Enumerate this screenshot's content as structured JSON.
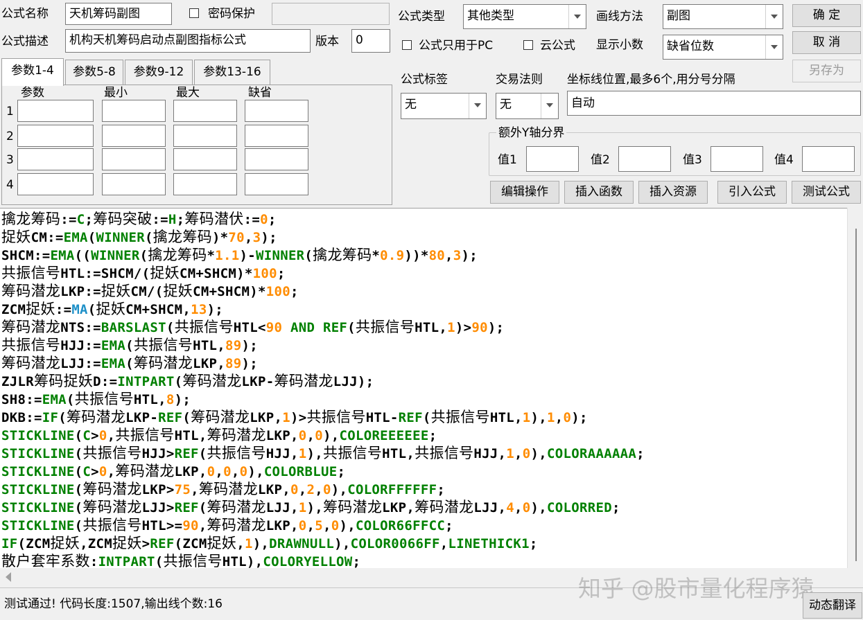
{
  "header": {
    "name_label": "公式名称",
    "name_value": "天机筹码副图",
    "password_label": "密码保护",
    "desc_label": "公式描述",
    "desc_value": "机构天机筹码启动点副图指标公式",
    "version_label": "版本",
    "version_value": "0",
    "type_label": "公式类型",
    "type_value": "其他类型",
    "draw_label": "画线方法",
    "draw_value": "副图",
    "pc_only_label": "公式只用于PC",
    "cloud_label": "云公式",
    "decimals_label": "显示小数",
    "decimals_value": "缺省位数",
    "ok_label": "确 定",
    "cancel_label": "取 消",
    "saveas_label": "另存为"
  },
  "tabs": [
    "参数1-4",
    "参数5-8",
    "参数9-12",
    "参数13-16"
  ],
  "params": {
    "headers": [
      "参数",
      "最小",
      "最大",
      "缺省"
    ],
    "rows": [
      "1",
      "2",
      "3",
      "4"
    ]
  },
  "options": {
    "tag_label": "公式标签",
    "tag_value": "无",
    "trade_label": "交易法则",
    "trade_value": "无",
    "coord_label": "坐标线位置,最多6个,用分号分隔",
    "coord_value": "自动",
    "yaxis_label": "额外Y轴分界",
    "v1": "值1",
    "v2": "值2",
    "v3": "值3",
    "v4": "值4"
  },
  "actions": [
    "编辑操作",
    "插入函数",
    "插入资源",
    "引入公式",
    "测试公式"
  ],
  "code": [
    [
      [
        "id",
        "擒龙筹码"
      ],
      [
        "txt",
        ":="
      ],
      [
        "fn",
        "C"
      ],
      [
        "txt",
        ";"
      ],
      [
        "id",
        "筹码突破"
      ],
      [
        "txt",
        ":="
      ],
      [
        "fn",
        "H"
      ],
      [
        "txt",
        ";"
      ],
      [
        "id",
        "筹码潜伏"
      ],
      [
        "txt",
        ":="
      ],
      [
        "num",
        "0"
      ],
      [
        "txt",
        ";"
      ]
    ],
    [
      [
        "id",
        "捉妖"
      ],
      [
        "txt",
        "CM:="
      ],
      [
        "fn",
        "EMA"
      ],
      [
        "txt",
        "("
      ],
      [
        "fn",
        "WINNER"
      ],
      [
        "txt",
        "("
      ],
      [
        "id",
        "擒龙筹码"
      ],
      [
        "txt",
        ")*"
      ],
      [
        "num",
        "70"
      ],
      [
        "txt",
        ","
      ],
      [
        "num",
        "3"
      ],
      [
        "txt",
        ");"
      ]
    ],
    [
      [
        "txt",
        "SHCM:="
      ],
      [
        "fn",
        "EMA"
      ],
      [
        "txt",
        "(("
      ],
      [
        "fn",
        "WINNER"
      ],
      [
        "txt",
        "("
      ],
      [
        "id",
        "擒龙筹码"
      ],
      [
        "txt",
        "*"
      ],
      [
        "num",
        "1.1"
      ],
      [
        "txt",
        ")-"
      ],
      [
        "fn",
        "WINNER"
      ],
      [
        "txt",
        "("
      ],
      [
        "id",
        "擒龙筹码"
      ],
      [
        "txt",
        "*"
      ],
      [
        "num",
        "0.9"
      ],
      [
        "txt",
        "))*"
      ],
      [
        "num",
        "80"
      ],
      [
        "txt",
        ","
      ],
      [
        "num",
        "3"
      ],
      [
        "txt",
        ");"
      ]
    ],
    [
      [
        "id",
        "共振信号"
      ],
      [
        "txt",
        "HTL:=SHCM/("
      ],
      [
        "id",
        "捉妖"
      ],
      [
        "txt",
        "CM+SHCM)*"
      ],
      [
        "num",
        "100"
      ],
      [
        "txt",
        ";"
      ]
    ],
    [
      [
        "id",
        "筹码潜龙"
      ],
      [
        "txt",
        "LKP:="
      ],
      [
        "id",
        "捉妖"
      ],
      [
        "txt",
        "CM/("
      ],
      [
        "id",
        "捉妖"
      ],
      [
        "txt",
        "CM+SHCM)*"
      ],
      [
        "num",
        "100"
      ],
      [
        "txt",
        ";"
      ]
    ],
    [
      [
        "txt",
        "ZCM"
      ],
      [
        "id",
        "捉妖"
      ],
      [
        "txt",
        ":="
      ],
      [
        "ma",
        "MA"
      ],
      [
        "txt",
        "("
      ],
      [
        "id",
        "捉妖"
      ],
      [
        "txt",
        "CM+SHCM,"
      ],
      [
        "num",
        "13"
      ],
      [
        "txt",
        ");"
      ]
    ],
    [
      [
        "id",
        "筹码潜龙"
      ],
      [
        "txt",
        "NTS:="
      ],
      [
        "fn",
        "BARSLAST"
      ],
      [
        "txt",
        "("
      ],
      [
        "id",
        "共振信号"
      ],
      [
        "txt",
        "HTL<"
      ],
      [
        "num",
        "90"
      ],
      [
        "txt",
        " "
      ],
      [
        "kw",
        "AND"
      ],
      [
        "txt",
        " "
      ],
      [
        "fn",
        "REF"
      ],
      [
        "txt",
        "("
      ],
      [
        "id",
        "共振信号"
      ],
      [
        "txt",
        "HTL,"
      ],
      [
        "num",
        "1"
      ],
      [
        "txt",
        ")>"
      ],
      [
        "num",
        "90"
      ],
      [
        "txt",
        ");"
      ]
    ],
    [
      [
        "id",
        "共振信号"
      ],
      [
        "txt",
        "HJJ:="
      ],
      [
        "fn",
        "EMA"
      ],
      [
        "txt",
        "("
      ],
      [
        "id",
        "共振信号"
      ],
      [
        "txt",
        "HTL,"
      ],
      [
        "num",
        "89"
      ],
      [
        "txt",
        ");"
      ]
    ],
    [
      [
        "id",
        "筹码潜龙"
      ],
      [
        "txt",
        "LJJ:="
      ],
      [
        "fn",
        "EMA"
      ],
      [
        "txt",
        "("
      ],
      [
        "id",
        "筹码潜龙"
      ],
      [
        "txt",
        "LKP,"
      ],
      [
        "num",
        "89"
      ],
      [
        "txt",
        ");"
      ]
    ],
    [
      [
        "txt",
        "ZJLR"
      ],
      [
        "id",
        "筹码捉妖"
      ],
      [
        "txt",
        "D:="
      ],
      [
        "fn",
        "INTPART"
      ],
      [
        "txt",
        "("
      ],
      [
        "id",
        "筹码潜龙"
      ],
      [
        "txt",
        "LKP-"
      ],
      [
        "id",
        "筹码潜龙"
      ],
      [
        "txt",
        "LJJ);"
      ]
    ],
    [
      [
        "txt",
        "SH8:="
      ],
      [
        "fn",
        "EMA"
      ],
      [
        "txt",
        "("
      ],
      [
        "id",
        "共振信号"
      ],
      [
        "txt",
        "HTL,"
      ],
      [
        "num",
        "8"
      ],
      [
        "txt",
        ");"
      ]
    ],
    [
      [
        "txt",
        "DKB:="
      ],
      [
        "fn",
        "IF"
      ],
      [
        "txt",
        "("
      ],
      [
        "id",
        "筹码潜龙"
      ],
      [
        "txt",
        "LKP-"
      ],
      [
        "fn",
        "REF"
      ],
      [
        "txt",
        "("
      ],
      [
        "id",
        "筹码潜龙"
      ],
      [
        "txt",
        "LKP,"
      ],
      [
        "num",
        "1"
      ],
      [
        "txt",
        ")>"
      ],
      [
        "id",
        "共振信号"
      ],
      [
        "txt",
        "HTL-"
      ],
      [
        "fn",
        "REF"
      ],
      [
        "txt",
        "("
      ],
      [
        "id",
        "共振信号"
      ],
      [
        "txt",
        "HTL,"
      ],
      [
        "num",
        "1"
      ],
      [
        "txt",
        "),"
      ],
      [
        "num",
        "1"
      ],
      [
        "txt",
        ","
      ],
      [
        "num",
        "0"
      ],
      [
        "txt",
        ");"
      ]
    ],
    [
      [
        "fn",
        "STICKLINE"
      ],
      [
        "txt",
        "("
      ],
      [
        "fn",
        "C"
      ],
      [
        "txt",
        ">"
      ],
      [
        "num",
        "0"
      ],
      [
        "txt",
        ","
      ],
      [
        "id",
        "共振信号"
      ],
      [
        "txt",
        "HTL,"
      ],
      [
        "id",
        "筹码潜龙"
      ],
      [
        "txt",
        "LKP,"
      ],
      [
        "num",
        "0"
      ],
      [
        "txt",
        ","
      ],
      [
        "num",
        "0"
      ],
      [
        "txt",
        "),"
      ],
      [
        "fn",
        "COLOREEEEEE"
      ],
      [
        "txt",
        ";"
      ]
    ],
    [
      [
        "fn",
        "STICKLINE"
      ],
      [
        "txt",
        "("
      ],
      [
        "id",
        "共振信号"
      ],
      [
        "txt",
        "HJJ>"
      ],
      [
        "fn",
        "REF"
      ],
      [
        "txt",
        "("
      ],
      [
        "id",
        "共振信号"
      ],
      [
        "txt",
        "HJJ,"
      ],
      [
        "num",
        "1"
      ],
      [
        "txt",
        "),"
      ],
      [
        "id",
        "共振信号"
      ],
      [
        "txt",
        "HTL,"
      ],
      [
        "id",
        "共振信号"
      ],
      [
        "txt",
        "HJJ,"
      ],
      [
        "num",
        "1"
      ],
      [
        "txt",
        ","
      ],
      [
        "num",
        "0"
      ],
      [
        "txt",
        "),"
      ],
      [
        "fn",
        "COLORAAAAAA"
      ],
      [
        "txt",
        ";"
      ]
    ],
    [
      [
        "fn",
        "STICKLINE"
      ],
      [
        "txt",
        "("
      ],
      [
        "fn",
        "C"
      ],
      [
        "txt",
        ">"
      ],
      [
        "num",
        "0"
      ],
      [
        "txt",
        ","
      ],
      [
        "id",
        "筹码潜龙"
      ],
      [
        "txt",
        "LKP,"
      ],
      [
        "num",
        "0"
      ],
      [
        "txt",
        ","
      ],
      [
        "num",
        "0"
      ],
      [
        "txt",
        ","
      ],
      [
        "num",
        "0"
      ],
      [
        "txt",
        "),"
      ],
      [
        "fn",
        "COLORBLUE"
      ],
      [
        "txt",
        ";"
      ]
    ],
    [
      [
        "fn",
        "STICKLINE"
      ],
      [
        "txt",
        "("
      ],
      [
        "id",
        "筹码潜龙"
      ],
      [
        "txt",
        "LKP>"
      ],
      [
        "num",
        "75"
      ],
      [
        "txt",
        ","
      ],
      [
        "id",
        "筹码潜龙"
      ],
      [
        "txt",
        "LKP,"
      ],
      [
        "num",
        "0"
      ],
      [
        "txt",
        ","
      ],
      [
        "num",
        "2"
      ],
      [
        "txt",
        ","
      ],
      [
        "num",
        "0"
      ],
      [
        "txt",
        "),"
      ],
      [
        "fn",
        "COLORFFFFFF"
      ],
      [
        "txt",
        ";"
      ]
    ],
    [
      [
        "fn",
        "STICKLINE"
      ],
      [
        "txt",
        "("
      ],
      [
        "id",
        "筹码潜龙"
      ],
      [
        "txt",
        "LJJ>"
      ],
      [
        "fn",
        "REF"
      ],
      [
        "txt",
        "("
      ],
      [
        "id",
        "筹码潜龙"
      ],
      [
        "txt",
        "LJJ,"
      ],
      [
        "num",
        "1"
      ],
      [
        "txt",
        "),"
      ],
      [
        "id",
        "筹码潜龙"
      ],
      [
        "txt",
        "LKP,"
      ],
      [
        "id",
        "筹码潜龙"
      ],
      [
        "txt",
        "LJJ,"
      ],
      [
        "num",
        "4"
      ],
      [
        "txt",
        ","
      ],
      [
        "num",
        "0"
      ],
      [
        "txt",
        "),"
      ],
      [
        "fn",
        "COLORRED"
      ],
      [
        "txt",
        ";"
      ]
    ],
    [
      [
        "fn",
        "STICKLINE"
      ],
      [
        "txt",
        "("
      ],
      [
        "id",
        "共振信号"
      ],
      [
        "txt",
        "HTL>="
      ],
      [
        "num",
        "90"
      ],
      [
        "txt",
        ","
      ],
      [
        "id",
        "筹码潜龙"
      ],
      [
        "txt",
        "LKP,"
      ],
      [
        "num",
        "0"
      ],
      [
        "txt",
        ","
      ],
      [
        "num",
        "5"
      ],
      [
        "txt",
        ","
      ],
      [
        "num",
        "0"
      ],
      [
        "txt",
        "),"
      ],
      [
        "fn",
        "COLOR66FFCC"
      ],
      [
        "txt",
        ";"
      ]
    ],
    [
      [
        "fn",
        "IF"
      ],
      [
        "txt",
        "(ZCM"
      ],
      [
        "id",
        "捉妖"
      ],
      [
        "txt",
        ",ZCM"
      ],
      [
        "id",
        "捉妖"
      ],
      [
        "txt",
        ">"
      ],
      [
        "fn",
        "REF"
      ],
      [
        "txt",
        "(ZCM"
      ],
      [
        "id",
        "捉妖"
      ],
      [
        "txt",
        ","
      ],
      [
        "num",
        "1"
      ],
      [
        "txt",
        "),"
      ],
      [
        "fn",
        "DRAWNULL"
      ],
      [
        "txt",
        "),"
      ],
      [
        "fn",
        "COLOR0066FF"
      ],
      [
        "txt",
        ","
      ],
      [
        "fn",
        "LINETHICK1"
      ],
      [
        "txt",
        ";"
      ]
    ],
    [
      [
        "id",
        "散户套牢系数"
      ],
      [
        "txt",
        ":"
      ],
      [
        "fn",
        "INTPART"
      ],
      [
        "txt",
        "("
      ],
      [
        "id",
        "共振信号"
      ],
      [
        "txt",
        "HTL),"
      ],
      [
        "fn",
        "COLORYELLOW"
      ],
      [
        "txt",
        ";"
      ]
    ]
  ],
  "status": {
    "text": "测试通过! 代码长度:1507,输出线个数:16",
    "translate_label": "动态翻译",
    "watermark": "知乎 @股市量化程序猿"
  }
}
